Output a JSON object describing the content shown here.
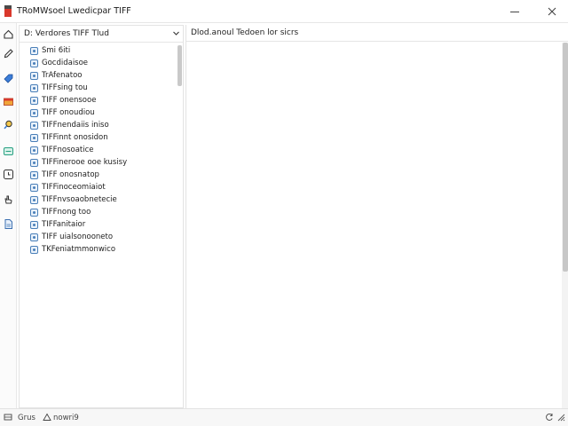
{
  "window": {
    "title": "TRoMWsoel Lwedicpar TIFF"
  },
  "left_panel": {
    "header": "D: Verdores TIFF Tlud",
    "files": [
      "Smi 6iti",
      "Gocdidaisoe",
      "TrAfenatoo",
      "TIFFsing tou",
      "TIFF onensooe",
      "TIFF onoudiou",
      "TIFFnendaiis iniso",
      "TIFFinnt onosidon",
      "TIFFnosoatice",
      "TIFFinerooe ooe kusisy",
      "TIFF onosnatop",
      "TIFFinoceomiaiot",
      "TIFFnvsoaobnetecie",
      "TIFFnong too",
      "TIFFanitaior",
      "TIFF uialsonooneto",
      "TKFeniatmmonwico"
    ]
  },
  "right_panel": {
    "header": "Dlod.anoul Tedoen lor sicrs"
  },
  "status": {
    "left_text": "Grus",
    "right_text": "nowri9"
  },
  "colors": {
    "accent": "#d9382c",
    "file_icon": "#4a7fb8"
  }
}
